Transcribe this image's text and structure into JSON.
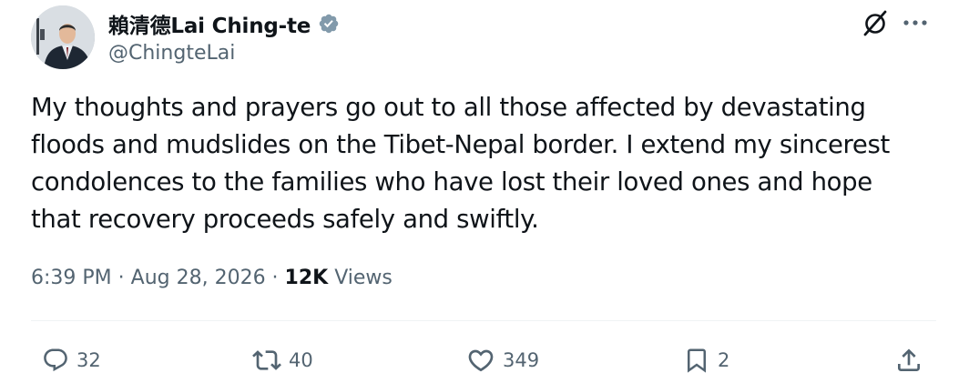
{
  "author": {
    "display_name": "賴清德Lai Ching-te",
    "handle": "@ChingteLai",
    "verified": true,
    "verified_badge_color": "#829aab"
  },
  "tweet": {
    "text": "My thoughts and prayers go out to all those affected by devastating\nfloods and mudslides on the Tibet-Nepal border. I extend my sincerest\ncondolences to the families who have lost their loved ones and hope\nthat recovery proceeds safely and swiftly.",
    "time": "6:39 PM",
    "separator": " · ",
    "date": "Aug 28, 2026",
    "views_count": "12K",
    "views_label": " Views"
  },
  "header_icons": {
    "grok": "grok-icon",
    "more": "more-icon"
  },
  "actions": {
    "reply": {
      "icon": "reply-icon",
      "count": "32"
    },
    "retweet": {
      "icon": "retweet-icon",
      "count": "40"
    },
    "like": {
      "icon": "heart-icon",
      "count": "349"
    },
    "bookmark": {
      "icon": "bookmark-icon",
      "count": "2"
    },
    "share": {
      "icon": "share-icon"
    }
  },
  "colors": {
    "text_primary": "#0f1419",
    "text_secondary": "#536471",
    "divider": "#eff3f4"
  }
}
